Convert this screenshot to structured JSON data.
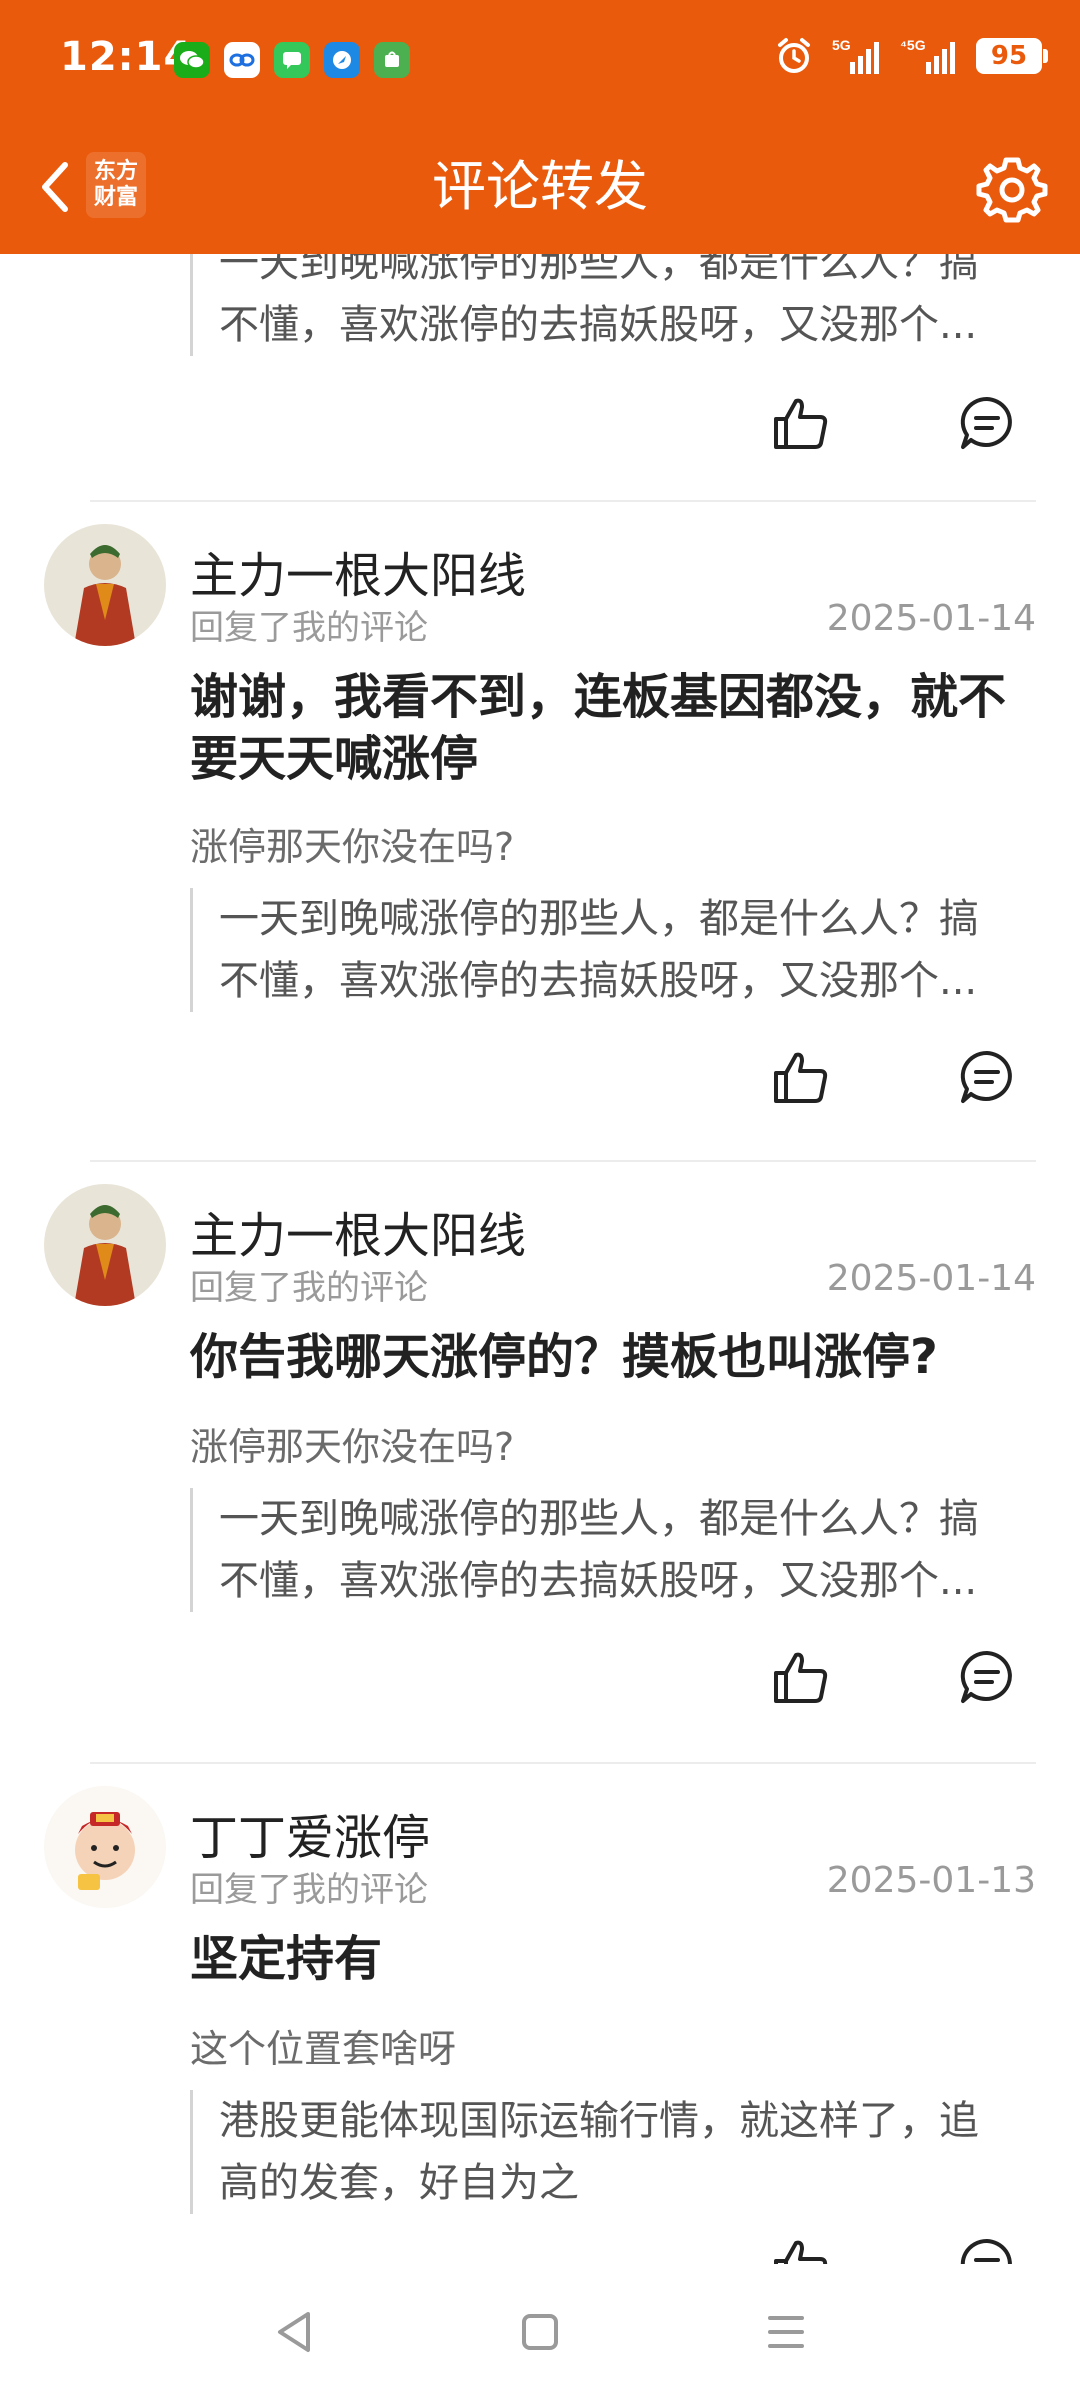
{
  "status_bar": {
    "time": "12:14",
    "battery": "95",
    "signal1": "5G",
    "signal2": "5G"
  },
  "header": {
    "logo_line1": "东方",
    "logo_line2": "财富",
    "title": "评论转发"
  },
  "colors": {
    "brand": "#EA5A0C"
  },
  "top_partial": {
    "quote_line1": "一天到晚喊涨停的那些人，都是什么人？搞",
    "quote_line2": "不懂，喜欢涨停的去搞妖股呀，又没那个..."
  },
  "items": [
    {
      "username": "主力一根大阳线",
      "action": "回复了我的评论",
      "date": "2025-01-14",
      "main_lines": [
        "谢谢，我看不到，连板基因都没，就不",
        "要天天喊涨停"
      ],
      "reply": "涨停那天你没在吗?",
      "quote_lines": [
        "一天到晚喊涨停的那些人，都是什么人？搞",
        "不懂，喜欢涨停的去搞妖股呀，又没那个..."
      ]
    },
    {
      "username": "主力一根大阳线",
      "action": "回复了我的评论",
      "date": "2025-01-14",
      "main_lines": [
        "你告我哪天涨停的？摸板也叫涨停?"
      ],
      "reply": "涨停那天你没在吗?",
      "quote_lines": [
        "一天到晚喊涨停的那些人，都是什么人？搞",
        "不懂，喜欢涨停的去搞妖股呀，又没那个..."
      ]
    },
    {
      "username": "丁丁爱涨停",
      "action": "回复了我的评论",
      "date": "2025-01-13",
      "main_lines": [
        "坚定持有"
      ],
      "reply": "这个位置套啥呀",
      "quote_lines": [
        "港股更能体现国际运输行情，就这样了，追",
        "高的发套，好自为之"
      ]
    }
  ]
}
